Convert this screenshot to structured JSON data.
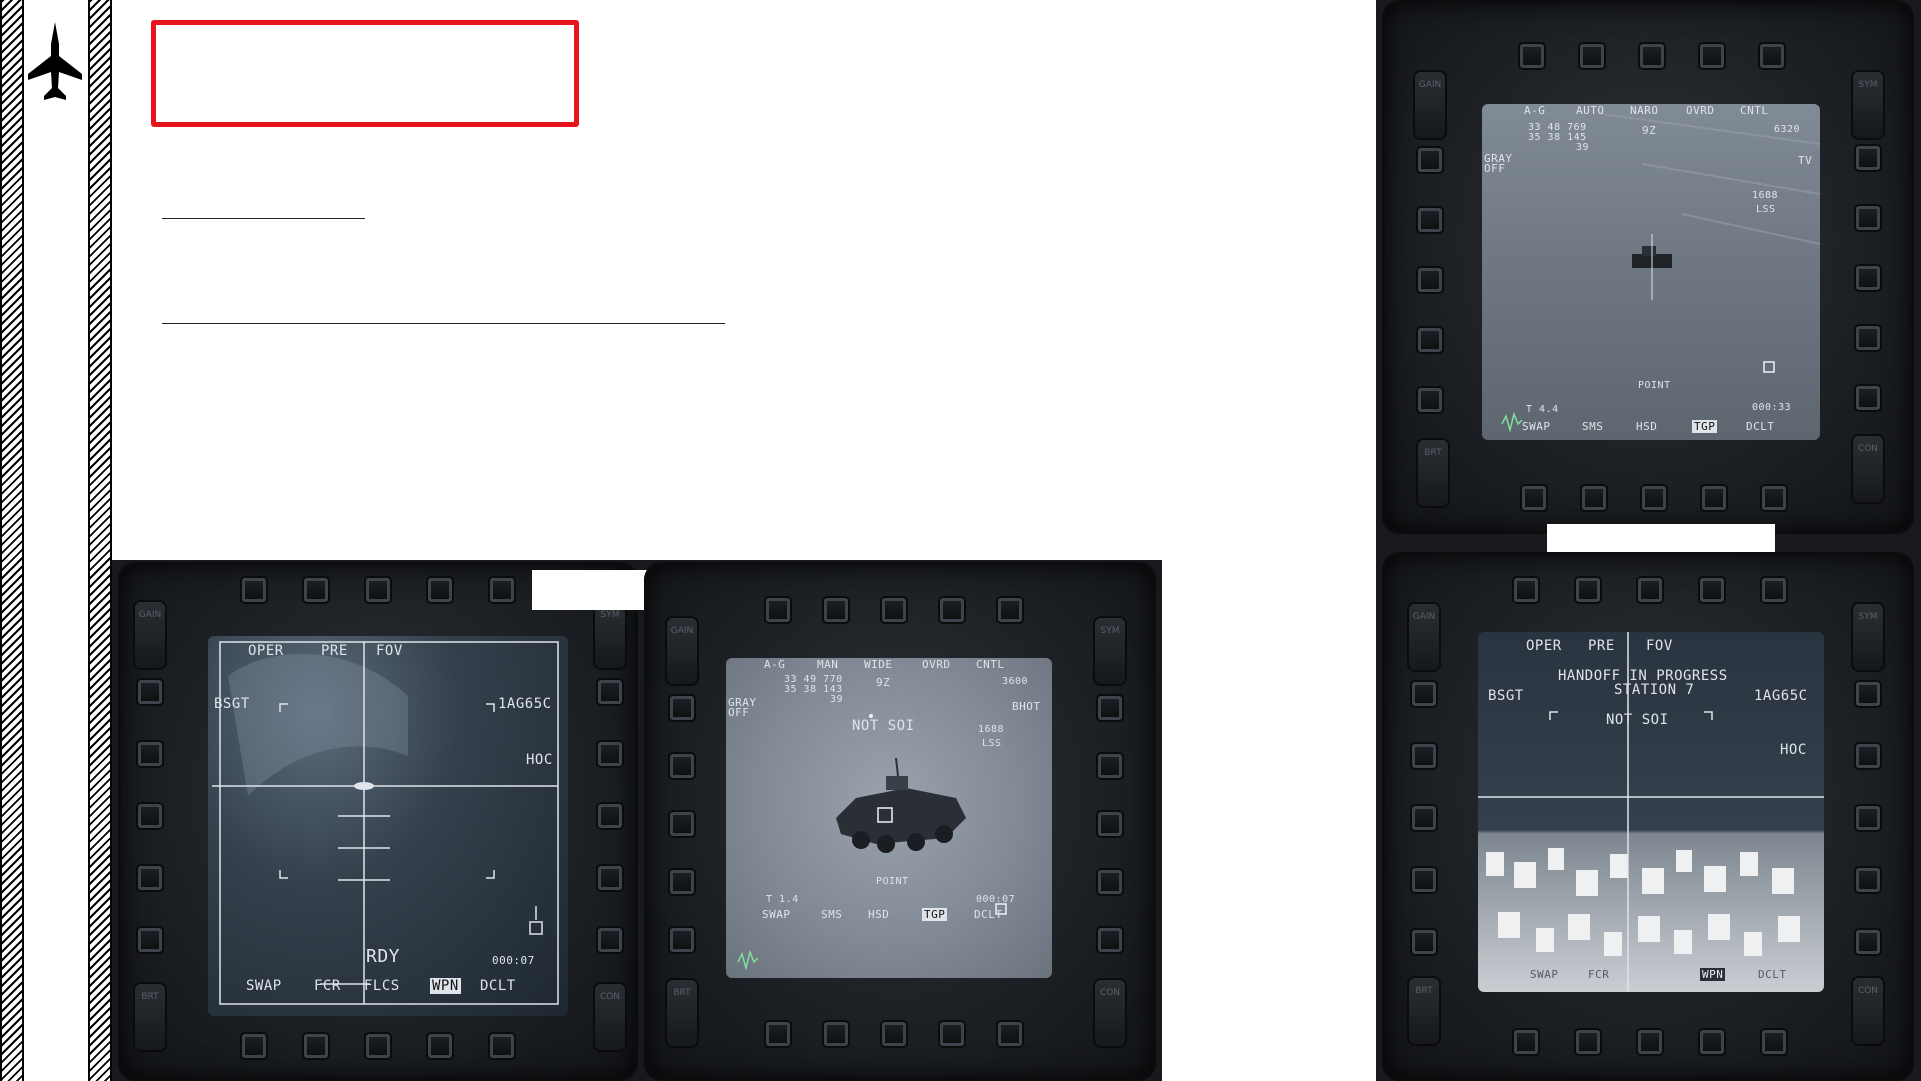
{
  "sidebar": {
    "logo_icon": "jet-silhouette-icon"
  },
  "colors": {
    "title_border": "#e8141c",
    "screen_text": "#dfe4ea",
    "bezel": "#1d2024"
  },
  "mfd_left_bottom": {
    "top_row": [
      "OPER",
      "PRE",
      "FOV"
    ],
    "left_label": "BSGT",
    "right_label": "1AG65C",
    "hoc": "HOC",
    "status": "RDY",
    "timer": "000:07",
    "bottom_row": [
      "SWAP",
      "FCR",
      "FLCS",
      "WPN",
      "DCLT"
    ],
    "selected": "WPN"
  },
  "mfd_center_bottom": {
    "top_row": [
      "A-G",
      "MAN",
      "WIDE",
      "OVRD",
      "CNTL"
    ],
    "coords": [
      "33 49 770",
      "35 38 143",
      "39"
    ],
    "heading": "9Z",
    "alt": "3600",
    "bhot": "BHOT",
    "gray": "GRAY",
    "off": "OFF",
    "not_soi": "NOT SOI",
    "range": "1688",
    "lss": "LSS",
    "mode": "POINT",
    "t_label": "T 1.4",
    "timer": "000:07",
    "bottom_row": [
      "SWAP",
      "SMS",
      "HSD",
      "TGP",
      "DCLT"
    ],
    "selected": "TGP"
  },
  "mfd_right_top": {
    "top_row": [
      "A-G",
      "AUTO",
      "NARO",
      "OVRD",
      "CNTL"
    ],
    "coords": [
      "33 48 769",
      "35 38 145",
      "39"
    ],
    "heading": "9Z",
    "alt": "6320",
    "tv": "TV",
    "gray": "GRAY",
    "off": "OFF",
    "range": "1688",
    "lss": "LSS",
    "mode": "POINT",
    "t_label": "T 4.4",
    "timer": "000:33",
    "bottom_row": [
      "SWAP",
      "SMS",
      "HSD",
      "TGP",
      "DCLT"
    ],
    "selected": "TGP"
  },
  "mfd_right_bottom": {
    "top_row": [
      "OPER",
      "PRE",
      "FOV"
    ],
    "handoff": "HANDOFF IN PROGRESS",
    "station": "STATION 7",
    "left_label": "BSGT",
    "right_label": "1AG65C",
    "not_soi": "NOT SOI",
    "hoc": "HOC",
    "bottom_row": [
      "SWAP",
      "FCR",
      "WPN",
      "DCLT"
    ],
    "selected": "WPN"
  },
  "rocker_labels": {
    "gain": "GAIN",
    "sym": "SYM",
    "brt": "BRT",
    "con": "CON"
  }
}
